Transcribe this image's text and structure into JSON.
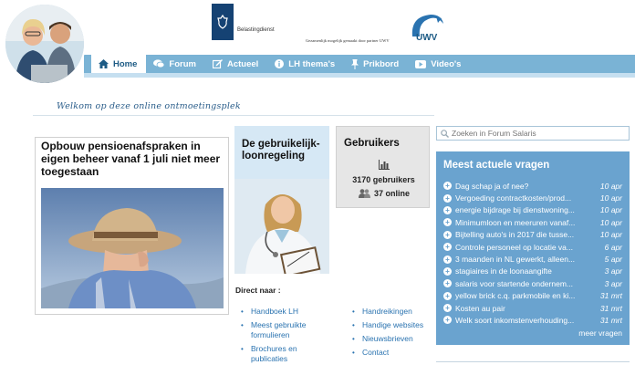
{
  "header": {
    "logo_text": "Belastingdienst",
    "partner_text": "Gezamenlijk mogelijk gemaakt door partner UWV",
    "uwv_logo_text": "UWV"
  },
  "nav": {
    "items": [
      {
        "label": "Home",
        "icon": "home-icon",
        "active": true
      },
      {
        "label": "Forum",
        "icon": "chat-icon",
        "active": false
      },
      {
        "label": "Actueel",
        "icon": "edit-icon",
        "active": false
      },
      {
        "label": "LH thema's",
        "icon": "info-icon",
        "active": false
      },
      {
        "label": "Prikbord",
        "icon": "pin-icon",
        "active": false
      },
      {
        "label": "Video's",
        "icon": "video-icon",
        "active": false
      }
    ]
  },
  "welcome": "Welkom op deze online ontmoetingsplek",
  "article": {
    "title": "Opbouw pensioenafspraken in eigen beheer vanaf 1 juli niet meer toegestaan"
  },
  "loonregeling": {
    "title": "De gebruikelijk-loonregeling"
  },
  "users": {
    "title": "Gebruikers",
    "count": "3170 gebruikers",
    "online": "37 online"
  },
  "direct": {
    "title": "Direct naar :",
    "left": [
      "Handboek LH",
      "Meest gebruikte formulieren",
      "Brochures en publicaties"
    ],
    "right": [
      "Handreikingen",
      "Handige websites",
      "Nieuwsbrieven",
      "Contact"
    ]
  },
  "search": {
    "placeholder": "Zoeken in Forum Salaris"
  },
  "questions": {
    "title": "Meest actuele vragen",
    "items": [
      {
        "text": "Dag schap ja of nee?",
        "date": "10 apr"
      },
      {
        "text": "Vergoeding contractkosten/prod...",
        "date": "10 apr"
      },
      {
        "text": "energie bijdrage bij dienstwoning...",
        "date": "10 apr"
      },
      {
        "text": "Minimumloon en meeruren vanaf...",
        "date": "10 apr"
      },
      {
        "text": "Bijtelling auto's in 2017 die tusse...",
        "date": "10 apr"
      },
      {
        "text": "Controle personeel op locatie va...",
        "date": "6 apr"
      },
      {
        "text": "3 maanden in NL gewerkt, alleen...",
        "date": "5 apr"
      },
      {
        "text": "stagiaires in de loonaangifte",
        "date": "3 apr"
      },
      {
        "text": "salaris voor startende ondernem...",
        "date": "3 apr"
      },
      {
        "text": "yellow brick c.q. parkmobile en ki...",
        "date": "31 mrt"
      },
      {
        "text": "Kosten au pair",
        "date": "31 mrt"
      },
      {
        "text": "Welk soort inkomstenverhouding...",
        "date": "31 mrt"
      }
    ],
    "more_label": "meer vragen"
  },
  "colors": {
    "nav": "#7ab3d5",
    "questions_panel": "#6aa3cf",
    "link": "#2a73b0",
    "loon_panel": "#d6e8f5"
  }
}
